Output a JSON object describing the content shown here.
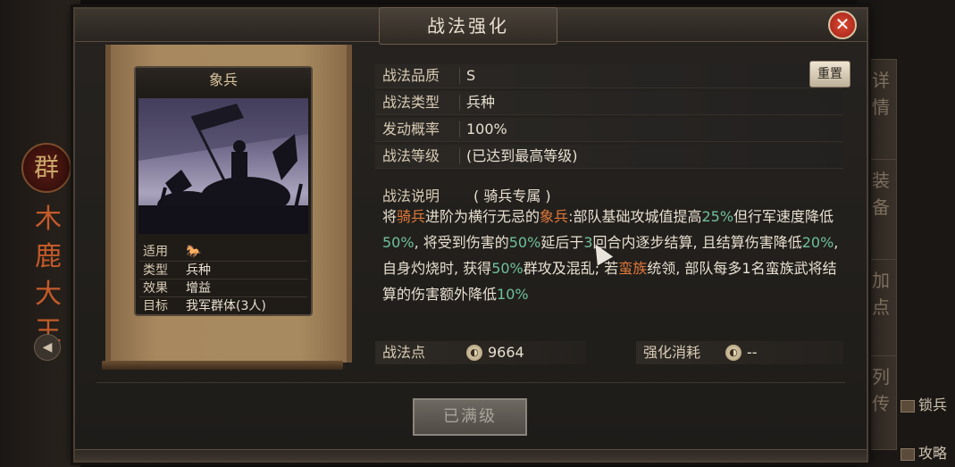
{
  "dialog": {
    "title": "战法强化",
    "close_symbol": "✕"
  },
  "card": {
    "name": "象兵",
    "props": [
      {
        "label": "适用",
        "value": ""
      },
      {
        "label": "类型",
        "value": "兵种"
      },
      {
        "label": "效果",
        "value": "增益"
      },
      {
        "label": "目标",
        "value": "我军群体(3人)"
      }
    ]
  },
  "info": {
    "quality_label": "战法品质",
    "quality_value": "S",
    "type_label": "战法类型",
    "type_value": "兵种",
    "rate_label": "发动概率",
    "rate_value": "100%",
    "level_label": "战法等级",
    "level_value": "(已达到最高等级)",
    "reset_label": "重置"
  },
  "description": {
    "label": "战法说明",
    "tag": "( 骑兵专属 )",
    "segments": [
      {
        "t": "将",
        "c": ""
      },
      {
        "t": "骑兵",
        "c": "o"
      },
      {
        "t": "进阶为横行无忌的",
        "c": ""
      },
      {
        "t": "象兵",
        "c": "o"
      },
      {
        "t": ":部队基础攻城值提高",
        "c": ""
      },
      {
        "t": "25%",
        "c": "g"
      },
      {
        "t": "但行军速度降低",
        "c": ""
      },
      {
        "t": "50%",
        "c": "g"
      },
      {
        "t": ", 将受到伤害的",
        "c": ""
      },
      {
        "t": "50%",
        "c": "g"
      },
      {
        "t": "延后于",
        "c": ""
      },
      {
        "t": "3",
        "c": "g"
      },
      {
        "t": "回合内逐步结算, 且结算伤害降低",
        "c": ""
      },
      {
        "t": "20%",
        "c": "g"
      },
      {
        "t": ", 自身灼烧时, 获得",
        "c": ""
      },
      {
        "t": "50%",
        "c": "g"
      },
      {
        "t": "群攻及混乱; 若",
        "c": ""
      },
      {
        "t": "蛮族",
        "c": "o"
      },
      {
        "t": "统领, 部队每多1名蛮族武将结算的伤害额外降低",
        "c": ""
      },
      {
        "t": "10%",
        "c": "g"
      }
    ]
  },
  "points": {
    "label": "战法点",
    "value": "9664",
    "cost_label": "强化消耗",
    "cost_value": "--",
    "coin_glyph": "◐"
  },
  "max_button": "已满级",
  "side_tabs": [
    "详情",
    "装备",
    "加点",
    "列传"
  ],
  "hero": {
    "badge": "群",
    "name": "木鹿大王",
    "speaker_glyph": "◀"
  },
  "right_edge": [
    "锁兵",
    "攻略"
  ]
}
